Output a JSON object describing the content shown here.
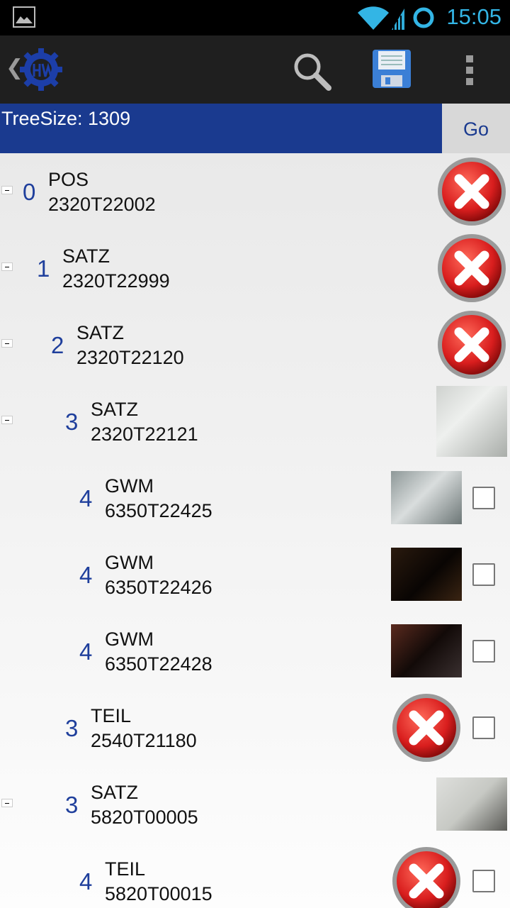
{
  "status_bar": {
    "time": "15:05",
    "icons": [
      "gallery-icon",
      "wifi-icon",
      "signal-icon",
      "sync-icon"
    ]
  },
  "action_bar": {
    "icons": [
      "back-icon",
      "app-logo-icon",
      "search-icon",
      "save-icon",
      "overflow-menu-icon"
    ]
  },
  "filter": {
    "tree_size_label": "TreeSize: 1309",
    "go_label": "Go"
  },
  "items": [
    {
      "level": "0",
      "type": "POS",
      "code": "2320T22002",
      "collapse": true,
      "image": "delete",
      "checkbox": false
    },
    {
      "level": "1",
      "type": "SATZ",
      "code": "2320T22999",
      "collapse": true,
      "image": "delete",
      "checkbox": false
    },
    {
      "level": "2",
      "type": "SATZ",
      "code": "2320T22120",
      "collapse": true,
      "image": "delete",
      "checkbox": false
    },
    {
      "level": "3",
      "type": "SATZ",
      "code": "2320T22121",
      "collapse": true,
      "image": "photo",
      "checkbox": false
    },
    {
      "level": "4",
      "type": "GWM",
      "code": "6350T22425",
      "collapse": false,
      "image": "photo",
      "checkbox": true
    },
    {
      "level": "4",
      "type": "GWM",
      "code": "6350T22426",
      "collapse": false,
      "image": "photo",
      "checkbox": true
    },
    {
      "level": "4",
      "type": "GWM",
      "code": "6350T22428",
      "collapse": false,
      "image": "photo",
      "checkbox": true
    },
    {
      "level": "3",
      "type": "TEIL",
      "code": "2540T21180",
      "collapse": false,
      "image": "delete",
      "checkbox": true
    },
    {
      "level": "3",
      "type": "SATZ",
      "code": "5820T00005",
      "collapse": true,
      "image": "photo",
      "checkbox": false
    },
    {
      "level": "4",
      "type": "TEIL",
      "code": "5820T00015",
      "collapse": false,
      "image": "delete",
      "checkbox": true
    }
  ],
  "colors": {
    "accent_blue": "#1a3a8f",
    "level_blue": "#1f3f9c",
    "delete_red": "#d91e1e",
    "clock_blue": "#33b5e5"
  }
}
